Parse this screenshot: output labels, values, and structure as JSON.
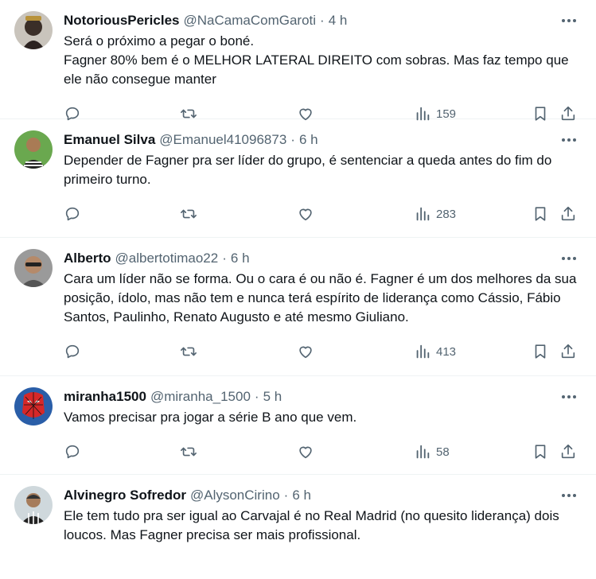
{
  "tweets": [
    {
      "name": "NotoriousPericles",
      "handle": "@NaCamaComGaroti",
      "time": "4 h",
      "text": "Será o próximo a pegar o boné.\nFagner 80% bem é o MELHOR LATERAL DIREITO com sobras. Mas faz tempo que ele não consegue manter",
      "views": "159"
    },
    {
      "name": "Emanuel Silva",
      "handle": "@Emanuel41096873",
      "time": "6 h",
      "text": "Depender de Fagner pra ser líder do grupo, é sentenciar a queda antes do fim do primeiro turno.",
      "views": "283"
    },
    {
      "name": "Alberto",
      "handle": "@albertotimao22",
      "time": "6 h",
      "text": "Cara um líder não se forma. Ou o cara é ou não é. Fagner é um dos melhores da sua posição, ídolo, mas não tem e nunca terá espírito de liderança como Cássio, Fábio Santos, Paulinho, Renato Augusto e até mesmo Giuliano.",
      "views": "413"
    },
    {
      "name": "miranha1500",
      "handle": "@miranha_1500",
      "time": "5 h",
      "text": "Vamos precisar pra jogar a série B ano que vem.",
      "views": "58"
    },
    {
      "name": "Alvinegro Sofredor",
      "handle": "@AlysonCirino",
      "time": "6 h",
      "text": "Ele tem tudo pra ser igual ao Carvajal é no Real Madrid (no quesito liderança) dois loucos. Mas Fagner precisa ser mais profissional.",
      "views": ""
    }
  ],
  "separator": "·",
  "icons": [
    "more-icon",
    "reply-icon",
    "retweet-icon",
    "like-icon",
    "views-icon",
    "bookmark-icon",
    "share-icon"
  ],
  "colors": {
    "text": "#0f1419",
    "secondary": "#536471",
    "border": "#eff3f4"
  }
}
